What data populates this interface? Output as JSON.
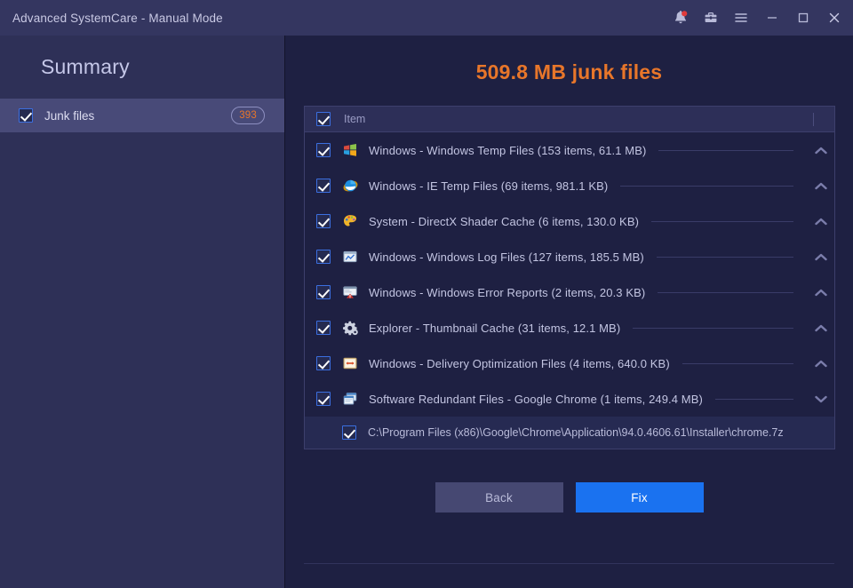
{
  "window": {
    "title": "Advanced SystemCare - Manual Mode",
    "controls": [
      {
        "name": "notification-bell-icon",
        "label": "Notifications"
      },
      {
        "name": "toolbox-icon",
        "label": "Toolbox"
      },
      {
        "name": "menu-icon",
        "label": "Menu"
      },
      {
        "name": "minimize-icon",
        "label": "Minimize"
      },
      {
        "name": "maximize-icon",
        "label": "Maximize"
      },
      {
        "name": "close-icon",
        "label": "Close"
      }
    ]
  },
  "sidebar": {
    "title": "Summary",
    "items": [
      {
        "label": "Junk files",
        "badge": "393",
        "checked": true
      }
    ]
  },
  "main": {
    "heading": "509.8 MB junk files",
    "list_header": {
      "label": "Item",
      "checked": true
    },
    "rows": [
      {
        "icon": "windows-logo-icon",
        "label": "Windows - Windows Temp Files (153 items, 61.1 MB)",
        "checked": true,
        "chevron": "up"
      },
      {
        "icon": "internet-explorer-icon",
        "label": "Windows - IE Temp Files (69 items, 981.1 KB)",
        "checked": true,
        "chevron": "up"
      },
      {
        "icon": "palette-icon",
        "label": "System - DirectX Shader Cache (6 items, 130.0 KB)",
        "checked": true,
        "chevron": "up"
      },
      {
        "icon": "log-file-icon",
        "label": "Windows - Windows Log Files (127 items, 185.5 MB)",
        "checked": true,
        "chevron": "up"
      },
      {
        "icon": "error-report-icon",
        "label": "Windows - Windows Error Reports (2 items, 20.3 KB)",
        "checked": true,
        "chevron": "up"
      },
      {
        "icon": "gear-icon",
        "label": "Explorer - Thumbnail Cache (31 items, 12.1 MB)",
        "checked": true,
        "chevron": "up"
      },
      {
        "icon": "delivery-optimization-icon",
        "label": "Windows - Delivery Optimization Files (4 items, 640.0 KB)",
        "checked": true,
        "chevron": "up"
      },
      {
        "icon": "chrome-window-icon",
        "label": "Software Redundant Files - Google Chrome (1 items, 249.4 MB)",
        "checked": true,
        "chevron": "down"
      }
    ],
    "subrows": [
      {
        "label": "C:\\Program Files (x86)\\Google\\Chrome\\Application\\94.0.4606.61\\Installer\\chrome.7z",
        "checked": true
      }
    ],
    "buttons": {
      "back": "Back",
      "fix": "Fix"
    }
  },
  "colors": {
    "titlebar": "#343660",
    "sidebar": "#2e3057",
    "sidebar_selected": "#484a78",
    "main_bg": "#1e2042",
    "accent_orange": "#e8762a",
    "accent_blue": "#1a72f0",
    "checkbox_border": "#3b6fe0",
    "text_primary": "#c3c5e2",
    "notification_dot": "#e03b3b"
  }
}
